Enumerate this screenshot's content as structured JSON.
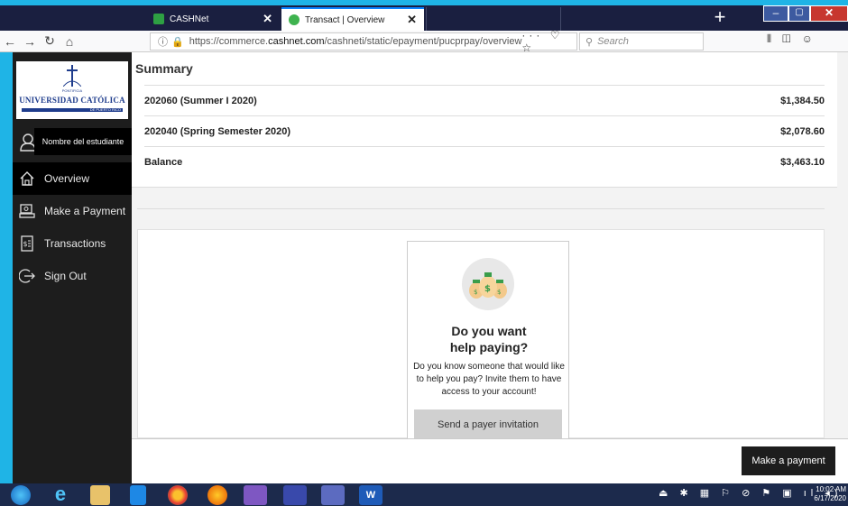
{
  "browser": {
    "tabs": [
      {
        "label": "CASHNet",
        "active": false
      },
      {
        "label": "Transact | Overview",
        "active": true
      }
    ],
    "url_prefix": "https://commerce.",
    "url_domain": "cashnet.com",
    "url_path": "/cashneti/static/epayment/pucprpay/overview",
    "url_actions": "··· ♡ ☆",
    "search_placeholder": "Search"
  },
  "sidebar": {
    "logo_small": "PONTIFICIA",
    "logo_name": "UNIVERSIDAD CATÓLICA",
    "logo_sub": "DE PUERTO RICO",
    "user_name": "Nombre del estudiante",
    "items": [
      {
        "label": "Overview",
        "icon": "home-icon",
        "active": true
      },
      {
        "label": "Make a Payment",
        "icon": "payment-icon",
        "active": false
      },
      {
        "label": "Transactions",
        "icon": "transactions-icon",
        "active": false
      },
      {
        "label": "Sign Out",
        "icon": "sign-out-icon",
        "active": false
      }
    ]
  },
  "summary": {
    "title": "Summary",
    "rows": [
      {
        "label": "202060 (Summer I 2020)",
        "amount": "$1,384.50"
      },
      {
        "label": "202040 (Spring Semester 2020)",
        "amount": "$2,078.60"
      },
      {
        "label": "Balance",
        "amount": "$3,463.10"
      }
    ]
  },
  "help": {
    "title_line1": "Do you want",
    "title_line2": "help paying?",
    "text": "Do you know someone that would like to help you pay? Invite them to have access to your account!",
    "button": "Send a payer invitation"
  },
  "footer": {
    "pay_button": "Make a payment"
  },
  "taskbar": {
    "time": "10:02 AM",
    "date": "6/17/2020"
  },
  "colors": {
    "sidebar_bg": "#1d1d1d",
    "active_item_bg": "#000000",
    "desktop_bg": "#1fb4e6",
    "brand_blue": "#1e3c8c"
  }
}
